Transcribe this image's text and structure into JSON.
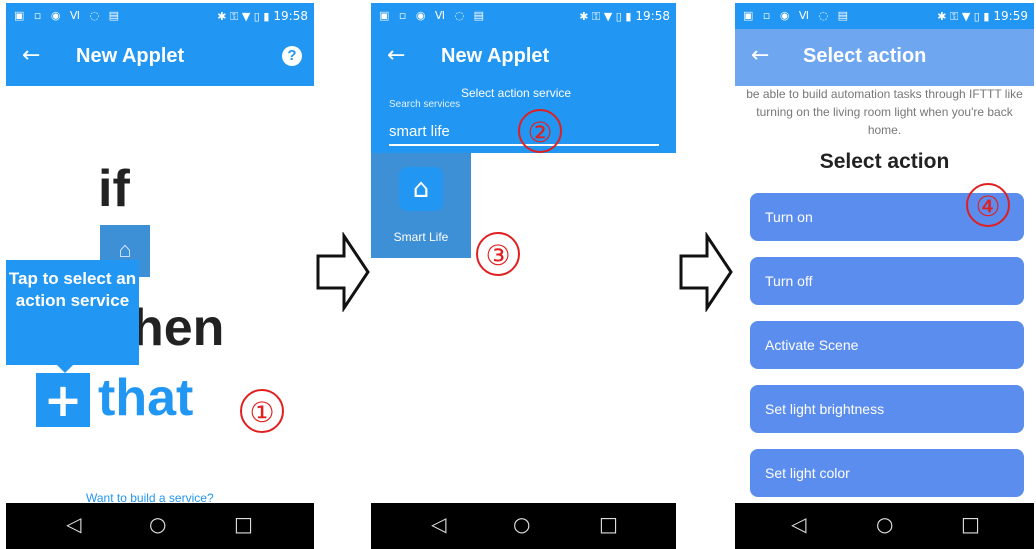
{
  "status": {
    "left_icons": "▣ ▫ ◉ Ⅵ ◌ ▤",
    "right_icons": "✱ ⚿ ▼ ▯ ▮"
  },
  "panel1": {
    "time": "19:58",
    "title": "New Applet",
    "back_icon": "arrow-left-icon",
    "help_glyph": "?",
    "if_text": "if",
    "hen_text": "hen",
    "tooltip_text": "Tap to select an action service",
    "plus_glyph": "+",
    "that_text": "that",
    "build_link": "Want to build a service?",
    "marker": "①"
  },
  "panel2": {
    "time": "19:58",
    "title": "New Applet",
    "subtitle": "Select action service",
    "search_label": "Search services",
    "search_value": "smart life",
    "marker_search": "②",
    "service_name": "Smart Life",
    "marker_service": "③"
  },
  "panel3": {
    "time": "19:59",
    "title": "Select action",
    "description": "be able to build automation tasks through IFTTT like turning on the living room light when you're back home.",
    "section_title": "Select action",
    "actions": [
      "Turn on",
      "Turn off",
      "Activate Scene",
      "Set light brightness",
      "Set light color"
    ],
    "marker": "④"
  },
  "nav": {
    "back": "◁",
    "home": "○",
    "recents": "□"
  },
  "colors": {
    "primary": "#2196f3",
    "action_button": "#5b8def",
    "marker": "#e02020"
  }
}
